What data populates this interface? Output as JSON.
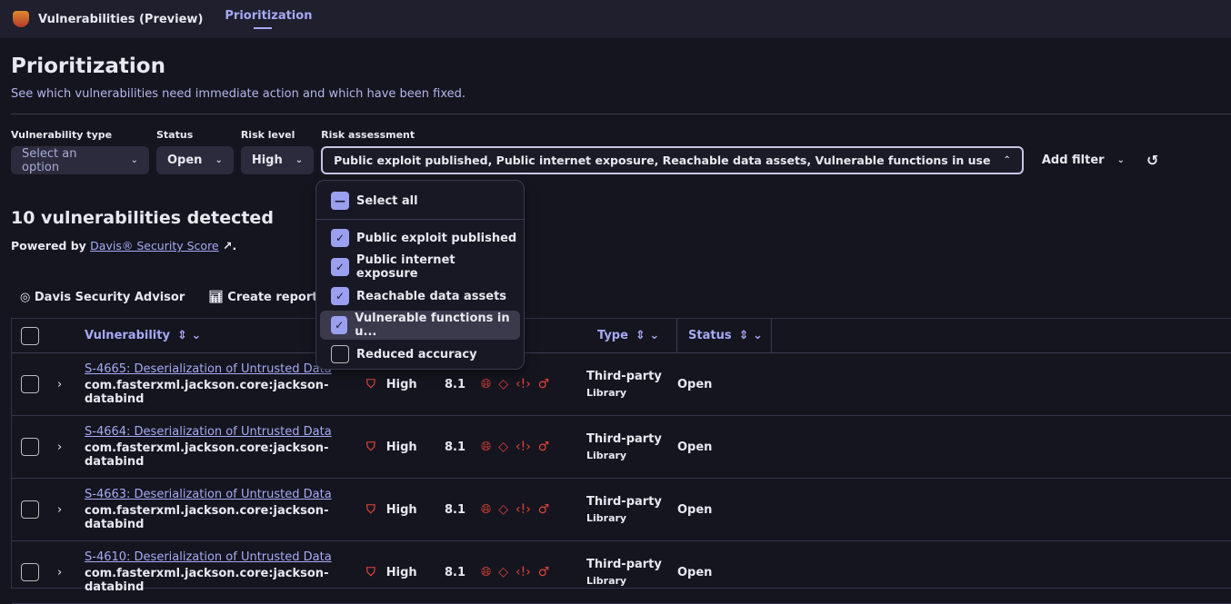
{
  "app": {
    "title": "Vulnerabilities (Preview)",
    "tab": "Prioritization"
  },
  "page": {
    "title": "Prioritization",
    "subtitle": "See which vulnerabilities need immediate action and which have been fixed."
  },
  "filters": {
    "vuln_type": {
      "label": "Vulnerability type",
      "placeholder": "Select an option"
    },
    "status": {
      "label": "Status",
      "value": "Open"
    },
    "risk_level": {
      "label": "Risk level",
      "value": "High"
    },
    "risk_assessment": {
      "label": "Risk assessment",
      "value": "Public exploit published, Public internet exposure, Reachable data assets, Vulnerable functions in use"
    },
    "add_filter": "Add filter"
  },
  "dropdown": {
    "select_all": "Select all",
    "options": [
      {
        "label": "Public exploit published",
        "checked": true
      },
      {
        "label": "Public internet exposure",
        "checked": true
      },
      {
        "label": "Reachable data assets",
        "checked": true
      },
      {
        "label": "Vulnerable functions in u...",
        "checked": true
      },
      {
        "label": "Reduced accuracy",
        "checked": false
      }
    ]
  },
  "summary": {
    "count": "10 vulnerabilities detected",
    "powered_prefix": "Powered by ",
    "powered_link": "Davis® Security Score",
    "powered_suffix": "."
  },
  "actions": {
    "advisor": "Davis Security Advisor",
    "report": "Create report"
  },
  "table": {
    "headers": {
      "vulnerability": "Vulnerability",
      "type": "Type",
      "status": "Status"
    },
    "rows": [
      {
        "title": "S-4665: Deserialization of Untrusted Data",
        "component": "com.fasterxml.jackson.core:jackson-databind",
        "risk": "High",
        "score": "8.1",
        "type": "Third-party",
        "subtype": "Library",
        "status": "Open"
      },
      {
        "title": "S-4664: Deserialization of Untrusted Data",
        "component": "com.fasterxml.jackson.core:jackson-databind",
        "risk": "High",
        "score": "8.1",
        "type": "Third-party",
        "subtype": "Library",
        "status": "Open"
      },
      {
        "title": "S-4663: Deserialization of Untrusted Data",
        "component": "com.fasterxml.jackson.core:jackson-databind",
        "risk": "High",
        "score": "8.1",
        "type": "Third-party",
        "subtype": "Library",
        "status": "Open"
      },
      {
        "title": "S-4610: Deserialization of Untrusted Data",
        "component": "com.fasterxml.jackson.core:jackson-databind",
        "risk": "High",
        "score": "8.1",
        "type": "Third-party",
        "subtype": "Library",
        "status": "Open"
      }
    ]
  }
}
